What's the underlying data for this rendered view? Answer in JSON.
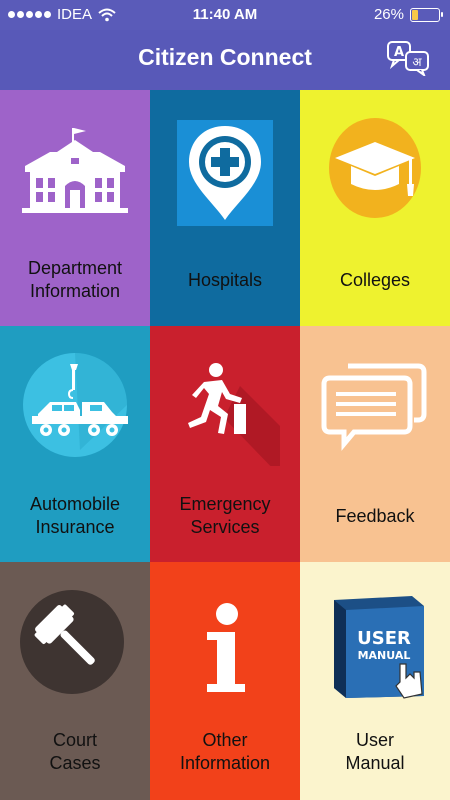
{
  "status_bar": {
    "carrier": "IDEA",
    "time": "11:40 AM",
    "battery_percent": "26%",
    "battery_level": 0.26
  },
  "header": {
    "title": "Citizen Connect",
    "language_icon": "translate-icon"
  },
  "tiles": [
    {
      "label": "Department\nInformation",
      "icon": "government-building-icon",
      "color": "#9e63c9"
    },
    {
      "label": "Hospitals",
      "icon": "hospital-pin-icon",
      "color": "#0f6b9f"
    },
    {
      "label": "Colleges",
      "icon": "graduation-cap-icon",
      "color": "#eef22f"
    },
    {
      "label": "Automobile\nInsurance",
      "icon": "tow-truck-icon",
      "color": "#1f9dc1"
    },
    {
      "label": "Emergency\nServices",
      "icon": "emergency-exit-icon",
      "color": "#c9202d"
    },
    {
      "label": "Feedback",
      "icon": "chat-bubbles-icon",
      "color": "#f8c291"
    },
    {
      "label": "Court\nCases",
      "icon": "gavel-icon",
      "color": "#6b5a53"
    },
    {
      "label": "Other\nInformation",
      "icon": "info-icon",
      "color": "#f2411a"
    },
    {
      "label": "User\nManual",
      "icon": "user-manual-book-icon",
      "color": "#fbf4cd"
    }
  ],
  "user_manual_book": {
    "line1": "USER",
    "line2": "MANUAL"
  }
}
